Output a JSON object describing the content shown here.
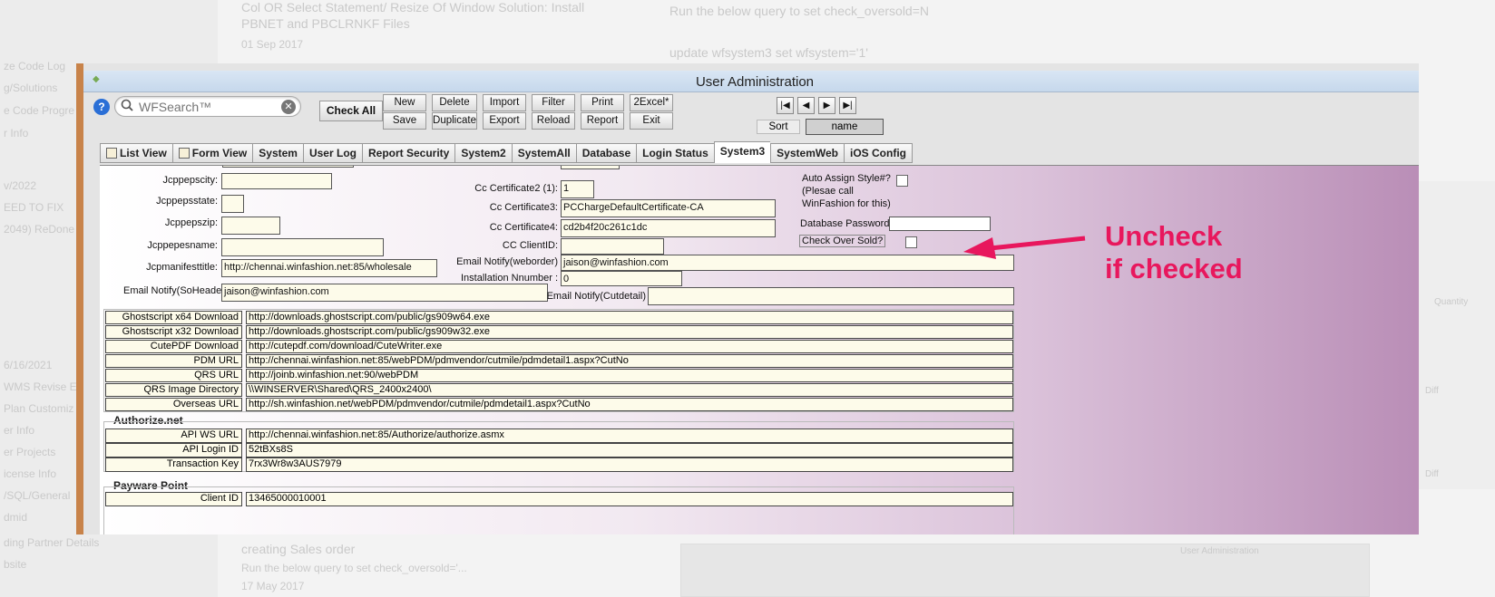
{
  "background": {
    "left_items": [
      "ze Code Log",
      "g/Solutions",
      "e Code Progre",
      "r Info",
      "v/2022",
      "EED TO FIX",
      "2049) ReDone",
      "6/16/2021",
      "WMS Revise E",
      "Plan Customiz",
      "er Info",
      "er Projects",
      "icense Info",
      "/SQL/General",
      "dmid",
      "ding Partner Details",
      "bsite"
    ],
    "top_left_line1": "Col OR Select Statement/ Resize Of Window Solution: Install",
    "top_left_line2": "PBNET and PBCLRNKF Files",
    "top_left_line3": "01 Sep 2017",
    "top_right_line1": "Run the below query to set check_oversold=N",
    "top_right_line2": "update wfsystem3 set wfsystem='1'",
    "bottom_left_line1": "creating Sales order",
    "bottom_left_line2": "Run the below query to set check_oversold='...",
    "bottom_left_line3": "17 May 2017",
    "bottom_sub_title": "User Administration",
    "right_labels": [
      "Quantity",
      "Diff",
      "Diff"
    ]
  },
  "window": {
    "title": "User Administration",
    "search_placeholder": "WFSearch™",
    "check_all": "Check All",
    "buttons_row1": [
      "New",
      "Delete",
      "Import",
      "Filter",
      "Print",
      "2Excel*"
    ],
    "buttons_row2": [
      "Save",
      "Duplicate",
      "Export",
      "Reload",
      "Report",
      "Exit"
    ],
    "sort_label": "Sort",
    "sort_value": "name",
    "nav": [
      "|◀",
      "◀",
      "▶",
      "▶|"
    ],
    "tabs": [
      "List View",
      "Form View",
      "System",
      "User Log",
      "Report Security",
      "System2",
      "SystemAll",
      "Database",
      "Login Status",
      "System3",
      "SystemWeb",
      "iOS Config"
    ],
    "active_tab": "System3"
  },
  "form": {
    "jcppepscity": {
      "label": "Jcppepscity:",
      "value": ""
    },
    "jcppepsstate": {
      "label": "Jcppepsstate:",
      "value": ""
    },
    "jcppepszip": {
      "label": "Jcppepszip:",
      "value": ""
    },
    "jcppepesname": {
      "label": "Jcppepesname:",
      "value": ""
    },
    "jcpmanifesttitle": {
      "label": "Jcpmanifesttitle:",
      "value": "http://chennai.winfashion.net:85/wholesale"
    },
    "email_soheader": {
      "label": "Email Notify(SoHeader)",
      "value": "jaison@winfashion.com"
    },
    "cc_cert2": {
      "label": "Cc Certificate2 (1):",
      "value": "1"
    },
    "cc_cert3": {
      "label": "Cc Certificate3:",
      "value": "PCChargeDefaultCertificate-CA"
    },
    "cc_cert4": {
      "label": "Cc Certificate4:",
      "value": "cd2b4f20c261c1dc"
    },
    "cc_clientid": {
      "label": "CC ClientID:",
      "value": ""
    },
    "email_weborder": {
      "label": "Email Notify(weborder)",
      "value": "jaison@winfashion.com"
    },
    "install_number": {
      "label": "Installation Nnumber :",
      "value": "0"
    },
    "email_cutdetail": {
      "label": "Email Notify(Cutdetail)",
      "value": ""
    },
    "auto_assign": {
      "label_line1": "Auto Assign Style#?",
      "label_line2": "(Plesae call",
      "label_line3": "WinFashion for this)"
    },
    "db_password": {
      "label": "Database Password",
      "value": ""
    },
    "check_over_sold": {
      "label": "Check Over Sold?"
    }
  },
  "downloads": [
    {
      "label": "Ghostscript x64 Download",
      "value": "http://downloads.ghostscript.com/public/gs909w64.exe"
    },
    {
      "label": "Ghostscript x32 Download",
      "value": "http://downloads.ghostscript.com/public/gs909w32.exe"
    },
    {
      "label": "CutePDF Download",
      "value": "http://cutepdf.com/download/CuteWriter.exe"
    },
    {
      "label": "PDM URL",
      "value": "http://chennai.winfashion.net:85/webPDM/pdmvendor/cutmile/pdmdetail1.aspx?CutNo"
    },
    {
      "label": "QRS URL",
      "value": "http://joinb.winfashion.net:90/webPDM"
    },
    {
      "label": "QRS Image Directory",
      "value": "\\\\WINSERVER\\Shared\\QRS_2400x2400\\"
    },
    {
      "label": "Overseas URL",
      "value": "http://sh.winfashion.net/webPDM/pdmvendor/cutmile/pdmdetail1.aspx?CutNo"
    }
  ],
  "authorize": {
    "title": "Authorize.net",
    "rows": [
      {
        "label": "API WS URL",
        "value": "http://chennai.winfashion.net:85/Authorize/authorize.asmx"
      },
      {
        "label": "API Login ID",
        "value": "52tBXs8S"
      },
      {
        "label": "Transaction Key",
        "value": "7rx3Wr8w3AUS7979"
      }
    ]
  },
  "payware": {
    "title": "Payware Point",
    "rows": [
      {
        "label": "Client ID",
        "value": "13465000010001"
      }
    ]
  },
  "annotation": {
    "line1": "Uncheck",
    "line2": "if checked",
    "color": "#e8175d"
  }
}
